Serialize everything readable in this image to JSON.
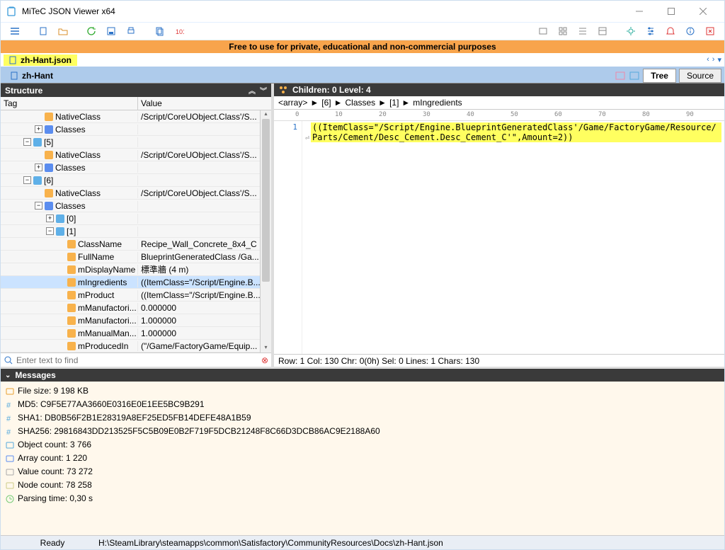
{
  "app": {
    "title": "MiTeC JSON Viewer x64"
  },
  "banner": "Free to use for private, educational and non-commercial  purposes",
  "filetab": "zh-Hant.json",
  "doctab": "zh-Hant",
  "viewtabs": {
    "tree": "Tree",
    "source": "Source"
  },
  "structure": {
    "title": "Structure",
    "headers": {
      "tag": "Tag",
      "value": "Value"
    },
    "search_placeholder": "Enter text to find",
    "rows": [
      {
        "indent": 48,
        "tw": "",
        "icon": "str",
        "tag": "NativeClass",
        "value": "/Script/CoreUObject.Class'/S..."
      },
      {
        "indent": 48,
        "tw": "+",
        "icon": "arr",
        "tag": "Classes",
        "value": ""
      },
      {
        "indent": 32,
        "tw": "-",
        "icon": "obj",
        "tag": "[5]",
        "value": ""
      },
      {
        "indent": 48,
        "tw": "",
        "icon": "str",
        "tag": "NativeClass",
        "value": "/Script/CoreUObject.Class'/S..."
      },
      {
        "indent": 48,
        "tw": "+",
        "icon": "arr",
        "tag": "Classes",
        "value": ""
      },
      {
        "indent": 32,
        "tw": "-",
        "icon": "obj",
        "tag": "[6]",
        "value": ""
      },
      {
        "indent": 48,
        "tw": "",
        "icon": "str",
        "tag": "NativeClass",
        "value": "/Script/CoreUObject.Class'/S..."
      },
      {
        "indent": 48,
        "tw": "-",
        "icon": "arr",
        "tag": "Classes",
        "value": ""
      },
      {
        "indent": 64,
        "tw": "+",
        "icon": "obj",
        "tag": "[0]",
        "value": ""
      },
      {
        "indent": 64,
        "tw": "-",
        "icon": "obj",
        "tag": "[1]",
        "value": ""
      },
      {
        "indent": 80,
        "tw": "",
        "icon": "str",
        "tag": "ClassName",
        "value": "Recipe_Wall_Concrete_8x4_C"
      },
      {
        "indent": 80,
        "tw": "",
        "icon": "str",
        "tag": "FullName",
        "value": "BlueprintGeneratedClass /Ga..."
      },
      {
        "indent": 80,
        "tw": "",
        "icon": "str",
        "tag": "mDisplayName",
        "value": "標準牆 (4 m)"
      },
      {
        "indent": 80,
        "tw": "",
        "icon": "str",
        "tag": "mIngredients",
        "value": "((ItemClass=\"/Script/Engine.B...",
        "sel": true
      },
      {
        "indent": 80,
        "tw": "",
        "icon": "str",
        "tag": "mProduct",
        "value": "((ItemClass=\"/Script/Engine.B..."
      },
      {
        "indent": 80,
        "tw": "",
        "icon": "str",
        "tag": "mManufactori...",
        "value": "0.000000"
      },
      {
        "indent": 80,
        "tw": "",
        "icon": "str",
        "tag": "mManufactori...",
        "value": "1.000000"
      },
      {
        "indent": 80,
        "tw": "",
        "icon": "str",
        "tag": "mManualMan...",
        "value": "1.000000"
      },
      {
        "indent": 80,
        "tw": "",
        "icon": "str",
        "tag": "mProducedIn",
        "value": "(\"/Game/FactoryGame/Equip..."
      }
    ]
  },
  "editor": {
    "header": "Children: 0   Level: 4",
    "crumbs": [
      "<array>",
      "[6]",
      "Classes",
      "[1]",
      "mIngredients"
    ],
    "ruler": [
      {
        "p": 30,
        "n": "0"
      },
      {
        "p": 86,
        "n": "10"
      },
      {
        "p": 148,
        "n": "20"
      },
      {
        "p": 210,
        "n": "30"
      },
      {
        "p": 272,
        "n": "40"
      },
      {
        "p": 334,
        "n": "50"
      },
      {
        "p": 396,
        "n": "60"
      },
      {
        "p": 458,
        "n": "70"
      },
      {
        "p": 520,
        "n": "80"
      },
      {
        "p": 582,
        "n": "90"
      }
    ],
    "line_no": "1",
    "content": "((ItemClass=\"/Script/Engine.BlueprintGeneratedClass'/Game/FactoryGame/Resource/Parts/Cement/Desc_Cement.Desc_Cement_C'\",Amount=2))",
    "status": "Row: 1   Col: 130   Chr: 0(0h)   Sel: 0   Lines: 1   Chars: 130"
  },
  "messages": {
    "title": "Messages",
    "items": [
      {
        "icon": "folder",
        "text": "File size: 9 198 KB"
      },
      {
        "icon": "hash",
        "text": "MD5: C9F5E77AA3660E0316E0E1EE5BC9B291"
      },
      {
        "icon": "hash",
        "text": "SHA1: DB0B56F2B1E28319A8EF25ED5FB14DEFE48A1B59"
      },
      {
        "icon": "hash",
        "text": "SHA256: 29816843DD213525F5C5B09E0B2F719F5DCB21248F8C66D3DCB86AC9E2188A60"
      },
      {
        "icon": "obj",
        "text": "Object count: 3 766"
      },
      {
        "icon": "arr",
        "text": "Array count: 1 220"
      },
      {
        "icon": "val",
        "text": "Value count: 73 272"
      },
      {
        "icon": "node",
        "text": "Node count: 78 258"
      },
      {
        "icon": "clock",
        "text": "Parsing time: 0,30 s"
      }
    ]
  },
  "statusbar": {
    "state": "Ready",
    "path": "H:\\SteamLibrary\\steamapps\\common\\Satisfactory\\CommunityResources\\Docs\\zh-Hant.json"
  }
}
